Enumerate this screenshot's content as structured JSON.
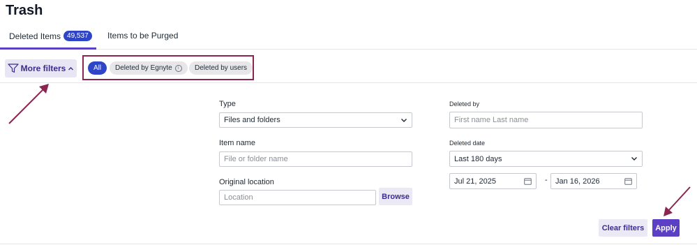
{
  "page": {
    "title": "Trash"
  },
  "tabs": [
    {
      "label": "Deleted Items",
      "count": "49,537",
      "active": true
    },
    {
      "label": "Items to be Purged",
      "active": false
    }
  ],
  "filters": {
    "more_label": "More filters",
    "chips": [
      "All",
      "Deleted by Egnyte",
      "Deleted by users"
    ],
    "info_glyph": "i"
  },
  "form": {
    "type_label": "Type",
    "type_value": "Files and folders",
    "item_name_label": "Item name",
    "item_name_placeholder": "File or folder name",
    "location_label": "Original location",
    "location_placeholder": "Location",
    "browse_label": "Browse",
    "deleted_by_label": "Deleted by",
    "deleted_by_placeholder": "First name Last name",
    "deleted_date_label": "Deleted date",
    "deleted_date_value": "Last 180 days",
    "date_from": "Jul 21, 2025",
    "date_to": "Jan 16, 2026",
    "date_separator": "-"
  },
  "actions": {
    "clear_label": "Clear filters",
    "apply_label": "Apply"
  },
  "colors": {
    "accent": "#5b3fc4",
    "badge": "#2f45c8",
    "annotation": "#8a2550"
  },
  "icons": [
    "filter-icon",
    "chevron-up-icon",
    "info-icon",
    "chevron-down-icon",
    "calendar-icon",
    "annotation-arrow"
  ]
}
